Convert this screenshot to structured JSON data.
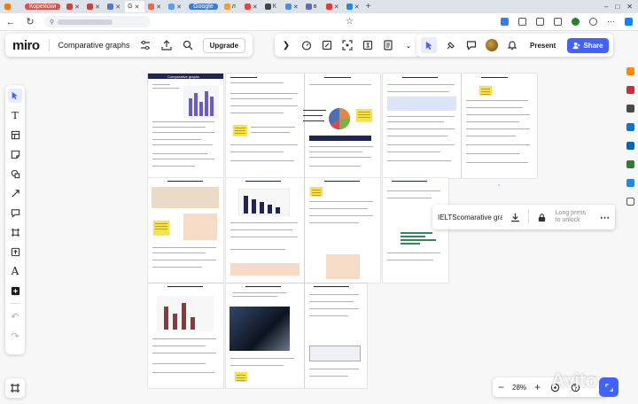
{
  "browser": {
    "tabs": [
      {
        "label": "Корейски",
        "style": "red"
      },
      {
        "label": "",
        "style": "plain"
      },
      {
        "label": "",
        "style": "plain"
      },
      {
        "label": "",
        "style": "plain"
      },
      {
        "label": "",
        "style": "plain"
      },
      {
        "label": "G",
        "style": "active"
      },
      {
        "label": "",
        "style": "plain"
      },
      {
        "label": "Google",
        "style": "blue"
      },
      {
        "label": "л",
        "style": "plain"
      },
      {
        "label": "",
        "style": "plain"
      },
      {
        "label": "К",
        "style": "plain"
      },
      {
        "label": "",
        "style": "plain"
      },
      {
        "label": "в",
        "style": "plain"
      },
      {
        "label": "",
        "style": "plain"
      },
      {
        "label": "",
        "style": "plain"
      }
    ],
    "new_tab": "+",
    "window_controls": [
      "–",
      "□",
      "✕"
    ],
    "nav": {
      "back": "←",
      "refresh": "↻",
      "star": "☆"
    }
  },
  "miro": {
    "logo": "miro",
    "board_title": "Comparative graphs",
    "upgrade_label": "Upgrade",
    "present_label": "Present",
    "share_label": "Share",
    "zoom": "28%",
    "colors": {
      "accent": "#4262ff",
      "note": "#f8e24a",
      "header": "#1f2550"
    }
  },
  "file_card": {
    "name": "IELTScomarative gra...",
    "lock_text_1": "Long press",
    "lock_text_2": "to unlock"
  },
  "canvas_pages": {
    "page_1_title": "Comparative graphs"
  },
  "watermark": "Avito"
}
